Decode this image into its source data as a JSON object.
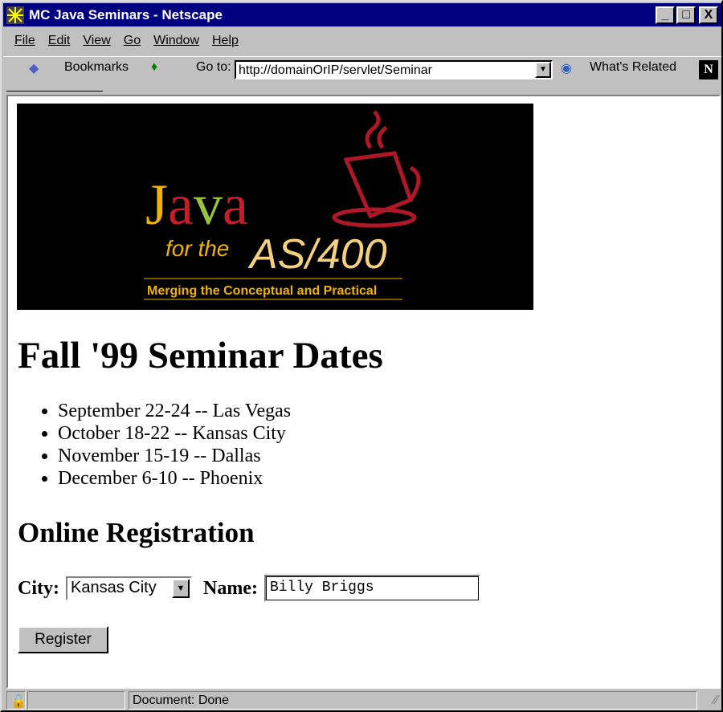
{
  "window": {
    "title": "MC Java Seminars - Netscape",
    "minimize": "_",
    "maximize": "□",
    "close": "X"
  },
  "menu": [
    "File",
    "Edit",
    "View",
    "Go",
    "Window",
    "Help"
  ],
  "toolbar": {
    "bookmarks": "Bookmarks",
    "goto_label": "Go to:",
    "url": "http://domainOrIP/servlet/Seminar",
    "whats_related": "What's Related",
    "netscape_logo": "N"
  },
  "page": {
    "logo": {
      "line1": "Java",
      "line2": "for the",
      "line3": "AS/400",
      "tagline": "Merging the Conceptual and Practical"
    },
    "heading": "Fall '99 Seminar Dates",
    "dates": [
      "September 22-24 -- Las Vegas",
      "October 18-22 -- Kansas City",
      "November 15-19 -- Dallas",
      "December 6-10 -- Phoenix"
    ],
    "subheading": "Online Registration",
    "form": {
      "city_label": "City:",
      "city_value": "Kansas City",
      "name_label": "Name:",
      "name_value": "Billy Briggs",
      "register": "Register"
    }
  },
  "status": {
    "text": "Document: Done"
  }
}
